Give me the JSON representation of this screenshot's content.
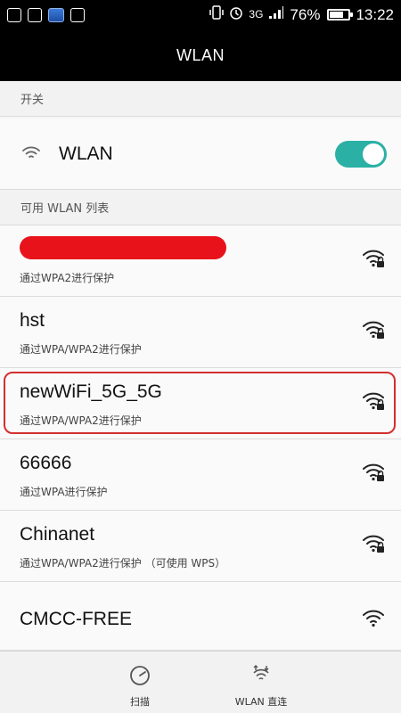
{
  "status_bar": {
    "network_type": "3G",
    "battery_percent": "76%",
    "battery_level": 0.76,
    "time": "13:22",
    "icons": [
      "image-icon",
      "gallery-icon",
      "power-app-icon",
      "android-icon",
      "vibrate-icon",
      "alarm-icon",
      "signal-icon",
      "battery-icon"
    ]
  },
  "header": {
    "title": "WLAN"
  },
  "sections": {
    "switch_header": "开关",
    "list_header": "可用 WLAN 列表"
  },
  "wlan_toggle": {
    "label": "WLAN",
    "enabled": true,
    "accent": "#2bb0a5"
  },
  "networks": [
    {
      "ssid": "",
      "redacted": true,
      "security": "通过WPA2进行保护",
      "locked": true
    },
    {
      "ssid": "hst",
      "security": "通过WPA/WPA2进行保护",
      "locked": true
    },
    {
      "ssid": "newWiFi_5G_5G",
      "security": "通过WPA/WPA2进行保护",
      "locked": true,
      "highlighted": true
    },
    {
      "ssid": "66666",
      "security": "通过WPA进行保护",
      "locked": true
    },
    {
      "ssid": "Chinanet",
      "security": "通过WPA/WPA2进行保护 （可使用 WPS）",
      "locked": true
    },
    {
      "ssid": "CMCC-FREE",
      "security": "",
      "locked": false
    }
  ],
  "bottom_bar": {
    "scan_label": "扫描",
    "direct_label": "WLAN 直连"
  },
  "colors": {
    "highlight": "#d32f2f",
    "redaction": "#e8121b"
  }
}
